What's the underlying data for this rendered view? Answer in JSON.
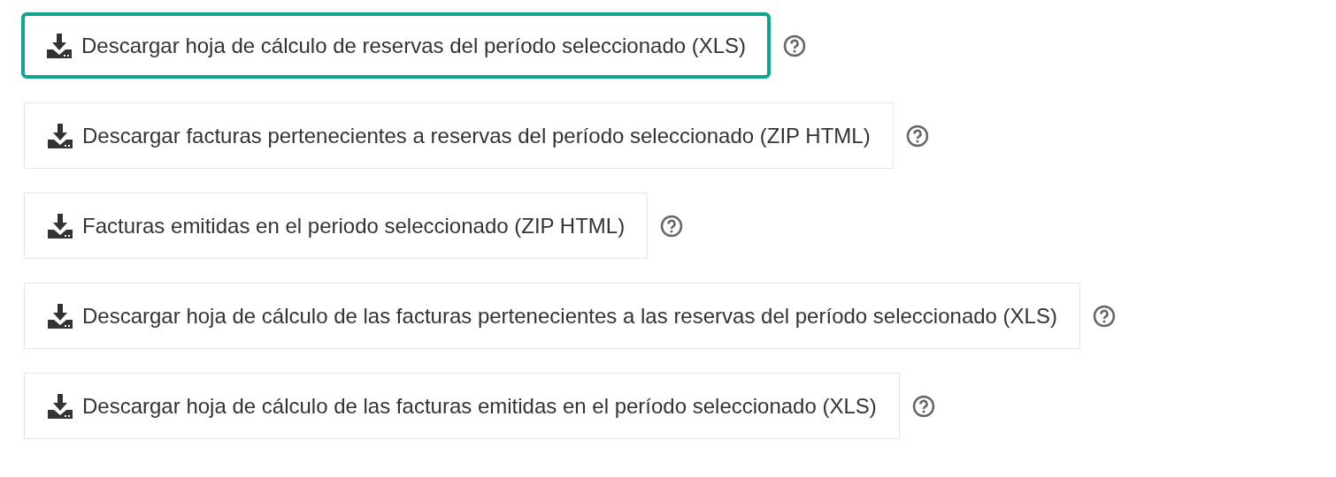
{
  "buttons": [
    {
      "label": "Descargar hoja de cálculo de reservas del período seleccionado (XLS)",
      "focused": true
    },
    {
      "label": "Descargar facturas pertenecientes a reservas del período seleccionado (ZIP HTML)",
      "focused": false
    },
    {
      "label": "Facturas emitidas en el periodo seleccionado (ZIP HTML)",
      "focused": false
    },
    {
      "label": "Descargar hoja de cálculo de las facturas pertenecientes a las reservas del período seleccionado (XLS)",
      "focused": false
    },
    {
      "label": "Descargar hoja de cálculo de las facturas emitidas en el período seleccionado (XLS)",
      "focused": false
    }
  ]
}
